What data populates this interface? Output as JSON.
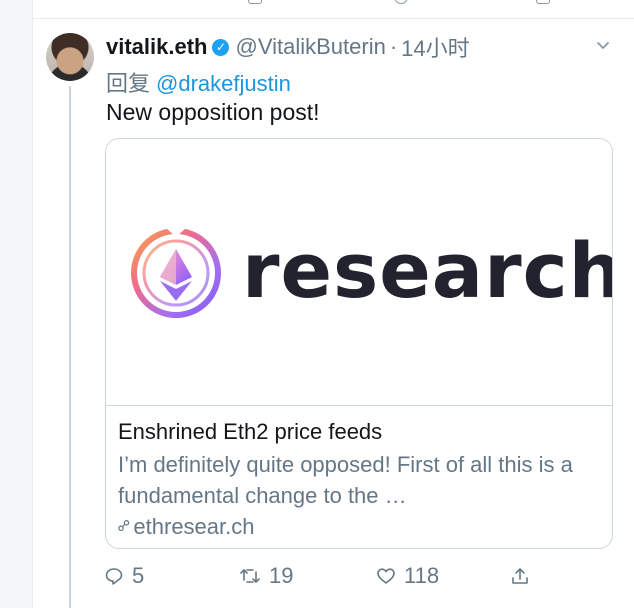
{
  "tweet": {
    "display_name": "vitalik.eth",
    "handle": "@VitalikButerin",
    "separator": "·",
    "time": "14小时",
    "reply_prefix": "回复",
    "reply_mention": "@drakefjustin",
    "text": "New opposition post!"
  },
  "card": {
    "wordmark": "research",
    "title": "Enshrined Eth2 price feeds",
    "description": "I’m definitely quite opposed! First of all this is a fundamental change to the …",
    "domain": "ethresear.ch"
  },
  "actions": {
    "reply_count": "5",
    "retweet_count": "19",
    "like_count": "118"
  },
  "icons": {
    "verified": "verified-badge-icon",
    "caret": "chevron-down-icon",
    "reply": "reply-icon",
    "retweet": "retweet-icon",
    "like": "heart-icon",
    "share": "share-icon",
    "link": "link-icon"
  },
  "colors": {
    "link_blue": "#1b95e0",
    "verified_blue": "#1da1f2",
    "secondary_text": "#657786",
    "border": "#ccd6dd"
  }
}
